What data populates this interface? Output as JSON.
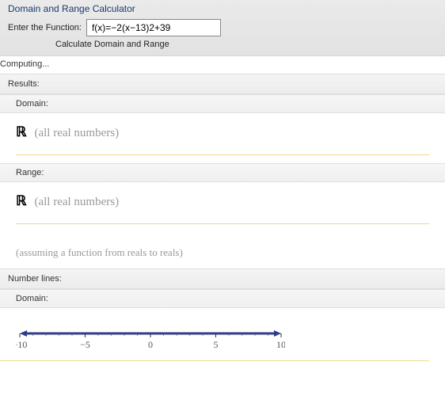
{
  "title": "Domain and Range Calculator",
  "input": {
    "label": "Enter the Function:",
    "value": "f(x)=−2(x−13)2+39"
  },
  "button_label": "Calculate Domain and Range",
  "computing_text": "Computing...",
  "results_heading": "Results:",
  "domain": {
    "heading": "Domain:",
    "symbol": "ℝ",
    "desc": "(all real numbers)"
  },
  "range": {
    "heading": "Range:",
    "symbol": "ℝ",
    "desc": "(all real numbers)"
  },
  "assumption": "(assuming a function from reals to reals)",
  "numberlines_heading": "Number lines:",
  "nl_domain_heading": "Domain:",
  "chart_data": {
    "type": "numberline",
    "axis_range": [
      -10,
      10
    ],
    "ticks": [
      -10,
      -5,
      0,
      5,
      10
    ],
    "highlight": {
      "from": -10,
      "to": 10,
      "open_left": true,
      "open_right": true
    }
  }
}
